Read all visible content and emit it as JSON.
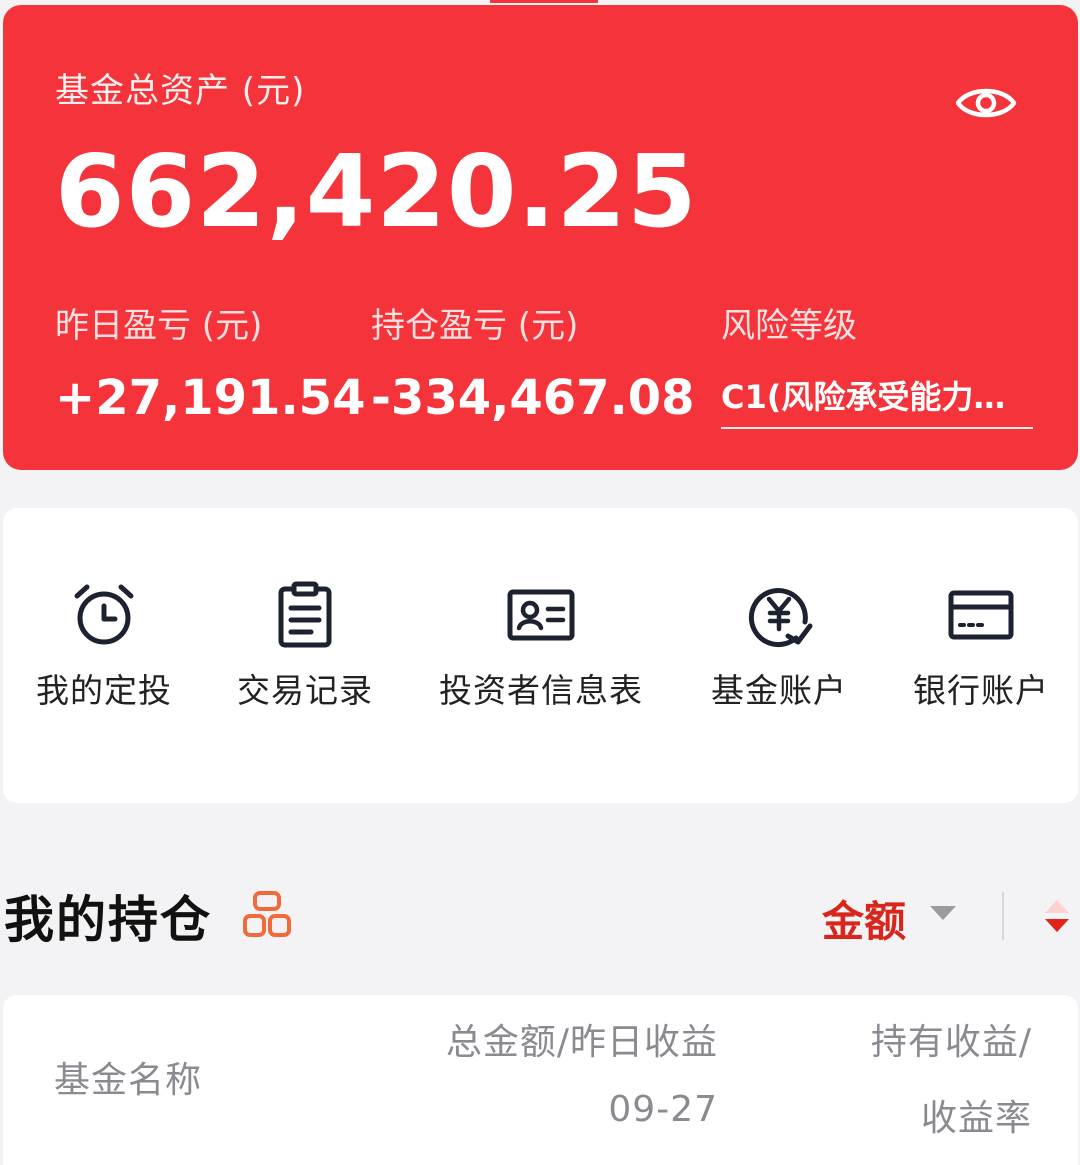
{
  "summary": {
    "title": "基金总资产 (元)",
    "total_assets": "662,420.25",
    "yesterday_pnl_label": "昨日盈亏 (元)",
    "yesterday_pnl_value": "+27,191.54",
    "holding_pnl_label": "持仓盈亏 (元)",
    "holding_pnl_value": "-334,467.08",
    "risk_label": "风险等级",
    "risk_value": "C1(风险承受能力…"
  },
  "shortcuts": [
    {
      "label": "我的定投",
      "icon": "alarm-clock-icon"
    },
    {
      "label": "交易记录",
      "icon": "clipboard-icon"
    },
    {
      "label": "投资者信息表",
      "icon": "id-card-icon"
    },
    {
      "label": "基金账户",
      "icon": "yuan-coin-icon"
    },
    {
      "label": "银行账户",
      "icon": "bank-card-icon"
    }
  ],
  "holdings": {
    "title": "我的持仓",
    "sort_label": "金额",
    "columns": {
      "name": "基金名称",
      "total_line1": "总金额/昨日收益",
      "total_line2": "09-27",
      "profit_line1": "持有收益/",
      "profit_line2": "收益率"
    }
  },
  "colors": {
    "brand_red": "#f4343a",
    "sort_active": "#d9261c",
    "icon_dark": "#1d2230",
    "icon_orange": "#f26a3a"
  }
}
